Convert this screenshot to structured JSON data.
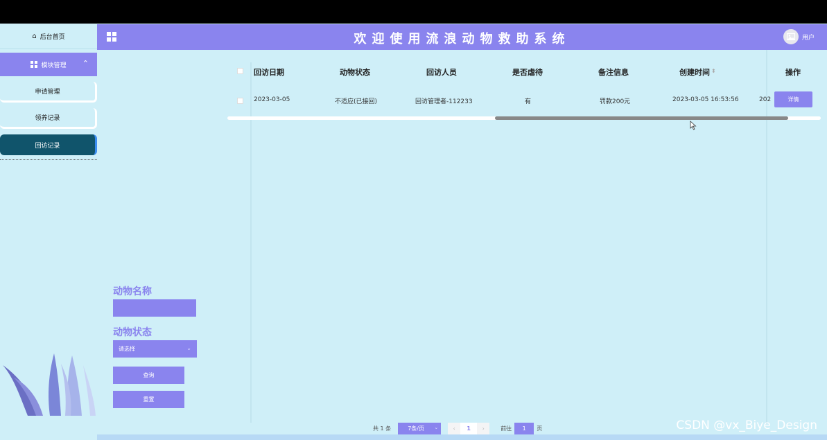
{
  "header": {
    "title": "欢迎使用流浪动物救助系统",
    "user_label": "用户"
  },
  "sidebar": {
    "home_label": "后台首页",
    "module_label": "模块管理",
    "items": [
      {
        "label": "申请管理",
        "active": false
      },
      {
        "label": "领养记录",
        "active": false
      },
      {
        "label": "回访记录",
        "active": true
      }
    ]
  },
  "table": {
    "columns": [
      "回访日期",
      "动物状态",
      "回访人员",
      "是否虐待",
      "备注信息",
      "创建时间",
      "操作"
    ],
    "sort_indicator": "⬍",
    "rows": [
      {
        "date": "2023-03-05",
        "status": "不适应(已接回)",
        "person": "回访管理者-112233",
        "abused": "有",
        "remark": "罚款200元",
        "created": "2023-03-05 16:53:56",
        "extra": "202",
        "action": "详情"
      }
    ]
  },
  "search": {
    "name_label": "动物名称",
    "name_value": "",
    "status_label": "动物状态",
    "status_placeholder": "请选择",
    "query_button": "查询",
    "reset_button": "重置"
  },
  "pagination": {
    "total": "共 1 条",
    "page_size": "7条/页",
    "current_page": "1",
    "goto_label": "前往",
    "goto_value": "1",
    "page_suffix": "页"
  },
  "watermark": "CSDN @vx_Biye_Design",
  "colors": {
    "accent": "#8a84ee",
    "background": "#cfeff8",
    "active_nav": "#10546b"
  }
}
